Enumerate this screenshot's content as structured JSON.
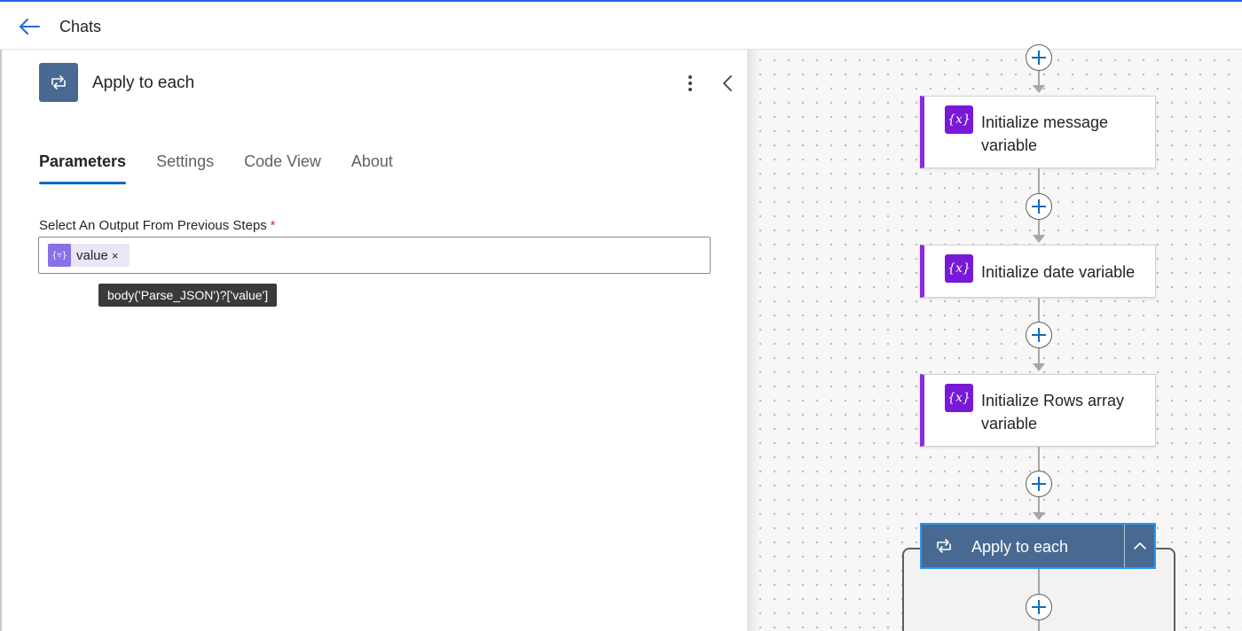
{
  "topbar": {
    "title": "Chats"
  },
  "panel": {
    "title": "Apply to each",
    "tabs": [
      {
        "label": "Parameters",
        "active": true
      },
      {
        "label": "Settings",
        "active": false
      },
      {
        "label": "Code View",
        "active": false
      },
      {
        "label": "About",
        "active": false
      }
    ],
    "field": {
      "label": "Select An Output From Previous Steps",
      "required_marker": "*",
      "token": {
        "icon": "{▿}",
        "text": "value",
        "remove": "×"
      },
      "tooltip": "body('Parse_JSON')?['value']"
    }
  },
  "canvas": {
    "cards": [
      {
        "label": "Initialize message variable",
        "icon": "{x}"
      },
      {
        "label": "Initialize date variable",
        "icon": "{x}"
      },
      {
        "label": "Initialize Rows array variable",
        "icon": "{x}"
      }
    ],
    "scope": {
      "label": "Apply to each"
    }
  },
  "colors": {
    "accent": "#0f6cbd",
    "variable_purple": "#7719d6",
    "loop_blue": "#486991",
    "selection_border": "#2899f5"
  }
}
